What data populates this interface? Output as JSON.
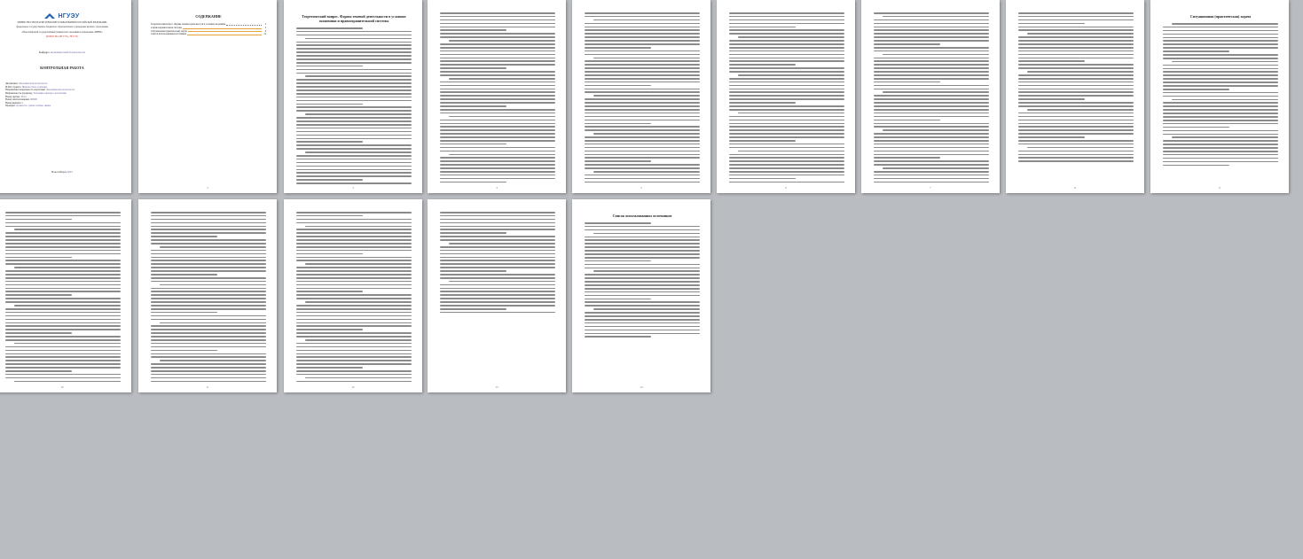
{
  "cover": {
    "logo_text": "НГУЭУ",
    "subtitle_lines": [
      "МИНИСТЕРСТВО НАУКИ И ВЫСШЕГО ОБРАЗОВАНИЯ РОССИЙСКОЙ ФЕДЕРАЦИИ",
      "федеральное государственное бюджетное образовательное учреждение высшего образования",
      "«Новосибирский государственный университет экономики и управления «НИНХ»"
    ],
    "red_line": "(ФГБОУ ВО «НГУЭУ», НГУЭУ)",
    "dept_label": "Кафедра",
    "dept_value": "экономической безопасности",
    "work_type": "КОНТРОЛЬНАЯ РАБОТА",
    "fields": [
      {
        "label": "Дисциплина:",
        "value": "Экономическая безопасность"
      },
      {
        "label": "Ф.И.О студента:",
        "value": "Иванова Ольга Сергеевна"
      },
      {
        "label": "Направление/специальность подготовки:",
        "value": "Экономическая безопасность"
      },
      {
        "label": "Направленность (профиль):",
        "value": "Экономико-правовое обеспечение"
      },
      {
        "label": "Номер группы:",
        "value": "ЭБ-01"
      },
      {
        "label": "Номер зачетной книжки:",
        "value": "000000"
      },
      {
        "label": "Номер варианта:",
        "value": "1"
      },
      {
        "label": "Проверил:",
        "value": "Должность, ученая степень, звание"
      }
    ],
    "city_label": "Новосибирск",
    "city_year": "2023"
  },
  "toc": {
    "title": "СОДЕРЖАНИЕ",
    "items": [
      {
        "text": "Теоретический вопрос. Формы теневой деятельности в условиях экономики",
        "page": "3",
        "highlight": false
      },
      {
        "text": "и правоохранительной системы",
        "page": "3",
        "highlight": true
      },
      {
        "text": "Ситуационная (практическая) задача",
        "page": "8",
        "highlight": true
      },
      {
        "text": "Список использованных источников",
        "page": "12",
        "highlight": true
      }
    ]
  },
  "headings": {
    "page3": "Теоретический вопрос. Формы теневой деятельности в условиях экономики и правоохранительной системы",
    "page9": "Ситуационная (практическая) задача",
    "page15": "Список использованных источников"
  },
  "page_numbers": [
    "",
    "2",
    "3",
    "4",
    "5",
    "6",
    "7",
    "8",
    "9",
    "10",
    "11",
    "12",
    "13",
    "14",
    "15"
  ]
}
